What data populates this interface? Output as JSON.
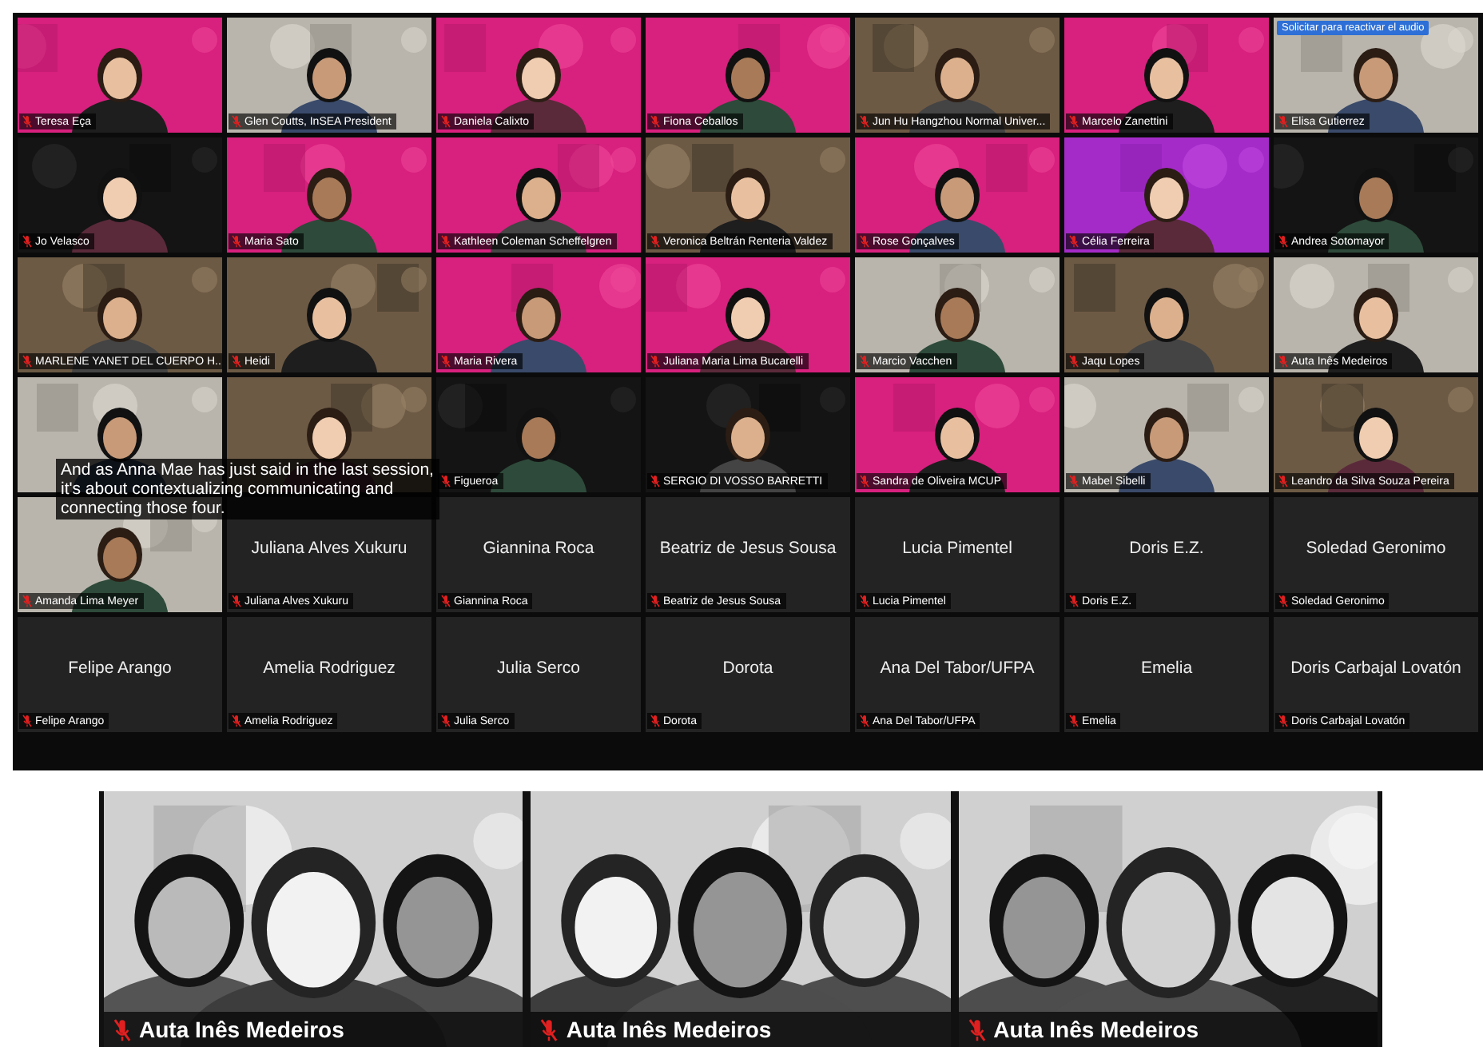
{
  "gallery": {
    "tiles": [
      {
        "kind": "video",
        "name": "Teresa Eça"
      },
      {
        "kind": "video",
        "name": "Glen Coutts, InSEA President"
      },
      {
        "kind": "video",
        "name": "Daniela Calixto"
      },
      {
        "kind": "video",
        "name": "Fiona Ceballos"
      },
      {
        "kind": "video",
        "name": "Jun Hu Hangzhou Normal Univer..."
      },
      {
        "kind": "video",
        "name": "Marcelo Zanettini"
      },
      {
        "kind": "video",
        "name": "Elisa Gutierrez",
        "banner": "Solicitar para reactivar el audio"
      },
      {
        "kind": "video",
        "name": "Jo Velasco"
      },
      {
        "kind": "video",
        "name": "Maria Sato"
      },
      {
        "kind": "video",
        "name": "Kathleen Coleman Scheffelgren"
      },
      {
        "kind": "video",
        "name": "Veronica Beltrán Renteria Valdez"
      },
      {
        "kind": "video",
        "name": "Rose Gonçalves"
      },
      {
        "kind": "video",
        "name": "Célia Ferreira"
      },
      {
        "kind": "video",
        "name": "Andrea Sotomayor"
      },
      {
        "kind": "video",
        "name": "MARLENE YANET DEL CUERPO H..."
      },
      {
        "kind": "video",
        "name": "Heidi"
      },
      {
        "kind": "video",
        "name": "Maria Rivera"
      },
      {
        "kind": "video",
        "name": "Juliana Maria Lima Bucarelli"
      },
      {
        "kind": "video",
        "name": "Marcio Vacchen"
      },
      {
        "kind": "video",
        "name": "Jaqu Lopes"
      },
      {
        "kind": "video",
        "name": "Auta Inês Medeiros"
      },
      {
        "kind": "video"
      },
      {
        "kind": "video"
      },
      {
        "kind": "video",
        "name": "Figueroa"
      },
      {
        "kind": "video",
        "name": "SERGIO DI VOSSO BARRETTI"
      },
      {
        "kind": "video",
        "name": "Sandra de Oliveira MCUP"
      },
      {
        "kind": "video",
        "name": "Mabel Sibelli"
      },
      {
        "kind": "video",
        "name": "Leandro da Silva Souza Pereira"
      },
      {
        "kind": "video",
        "name": "Amanda Lima Meyer"
      },
      {
        "kind": "name",
        "display_name": "Juliana Alves Xukuru",
        "name": "Juliana Alves Xukuru"
      },
      {
        "kind": "name",
        "display_name": "Giannina Roca",
        "name": "Giannina Roca"
      },
      {
        "kind": "name",
        "display_name": "Beatriz de Jesus Sousa",
        "name": "Beatriz de Jesus Sousa"
      },
      {
        "kind": "name",
        "display_name": "Lucia Pimentel",
        "name": "Lucia Pimentel"
      },
      {
        "kind": "name",
        "display_name": "Doris E.Z.",
        "name": "Doris E.Z."
      },
      {
        "kind": "name",
        "display_name": "Soledad Geronimo",
        "name": "Soledad Geronimo"
      },
      {
        "kind": "name",
        "display_name": "Felipe Arango",
        "name": "Felipe Arango"
      },
      {
        "kind": "name",
        "display_name": "Amelia Rodriguez",
        "name": "Amelia Rodriguez"
      },
      {
        "kind": "name",
        "display_name": "Julia Serco",
        "name": "Julia Serco"
      },
      {
        "kind": "name",
        "display_name": "Dorota",
        "name": "Dorota"
      },
      {
        "kind": "name",
        "display_name": "Ana Del Tabor/UFPA",
        "name": "Ana Del Tabor/UFPA"
      },
      {
        "kind": "name",
        "display_name": "Emelia",
        "name": "Emelia"
      },
      {
        "kind": "name",
        "display_name": "Doris Carbajal Lovatón",
        "name": "Doris Carbajal Lovatón"
      }
    ],
    "caption": "And as Anna Mae has just said in the last session, it's about contextualizing communicating and connecting those four."
  },
  "spotlight": [
    {
      "kind": "video",
      "name": "Auta Inês Medeiros"
    },
    {
      "kind": "video",
      "name": "Auta Inês Medeiros"
    },
    {
      "kind": "video",
      "name": "Auta Inês Medeiros"
    }
  ]
}
